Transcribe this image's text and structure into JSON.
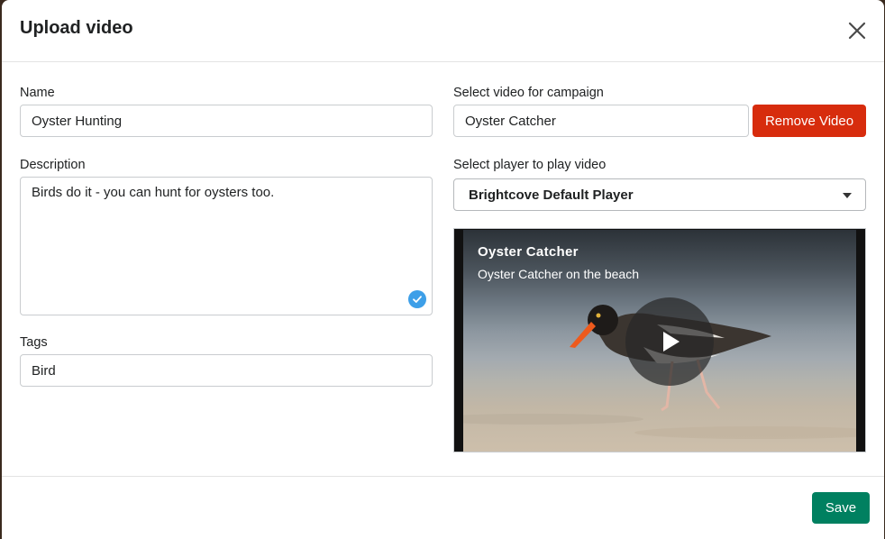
{
  "dialog": {
    "title": "Upload video",
    "close_icon": "close-icon"
  },
  "form": {
    "name_label": "Name",
    "name_value": "Oyster Hunting",
    "description_label": "Description",
    "description_value": "Birds do it - you can hunt for oysters too.",
    "tags_label": "Tags",
    "tags_value": "Bird"
  },
  "campaign": {
    "select_video_label": "Select video for campaign",
    "selected_video": "Oyster Catcher",
    "remove_button": "Remove Video",
    "select_player_label": "Select player to play video",
    "selected_player": "Brightcove Default Player"
  },
  "video_preview": {
    "title": "Oyster Catcher",
    "subtitle": "Oyster Catcher on the beach",
    "play_icon": "play-icon"
  },
  "footer": {
    "save_button": "Save"
  },
  "colors": {
    "remove_button": "#d72c0d",
    "save_button": "#008060",
    "check_badge": "#3d9fe8"
  }
}
